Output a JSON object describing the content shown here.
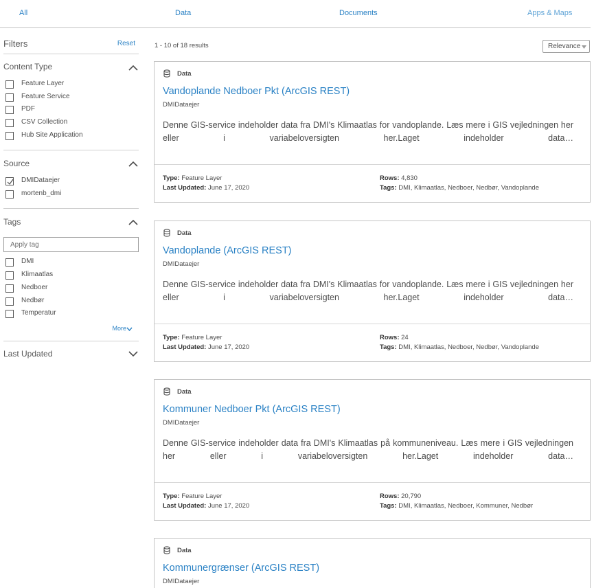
{
  "tabs": [
    {
      "label": "All"
    },
    {
      "label": "Data"
    },
    {
      "label": "Documents"
    },
    {
      "label": "Apps & Maps"
    }
  ],
  "filters": {
    "title": "Filters",
    "reset_label": "Reset",
    "content_type": {
      "title": "Content Type",
      "options": [
        {
          "label": "Feature Layer",
          "checked": false
        },
        {
          "label": "Feature Service",
          "checked": false
        },
        {
          "label": "PDF",
          "checked": false
        },
        {
          "label": "CSV Collection",
          "checked": false
        },
        {
          "label": "Hub Site Application",
          "checked": false
        }
      ]
    },
    "source": {
      "title": "Source",
      "options": [
        {
          "label": "DMIDataejer",
          "checked": true
        },
        {
          "label": "mortenb_dmi",
          "checked": false
        }
      ]
    },
    "tags": {
      "title": "Tags",
      "input_placeholder": "Apply tag",
      "options": [
        {
          "label": "DMI",
          "checked": false
        },
        {
          "label": "Klimaatlas",
          "checked": false
        },
        {
          "label": "Nedboer",
          "checked": false
        },
        {
          "label": "Nedbør",
          "checked": false
        },
        {
          "label": "Temperatur",
          "checked": false
        }
      ],
      "more_label": "More"
    },
    "last_updated": {
      "title": "Last Updated"
    }
  },
  "results": {
    "count_text": "1 - 10 of 18 results",
    "sort_label": "Relevance",
    "type_key": "Type:",
    "updated_key": "Last Updated:",
    "rows_key": "Rows:",
    "tags_key": "Tags:",
    "items": [
      {
        "kind": "Data",
        "title": "Vandoplande Nedboer Pkt (ArcGIS REST)",
        "owner": "DMIDataejer",
        "description": "Denne GIS-service indeholder data fra DMI's Klimaatlas for vandoplande. Læs mere i GIS vejledningen her eller i variabeloversigten her.Laget indeholder data…",
        "type": "Feature Layer",
        "last_updated": "June 17, 2020",
        "rows": "4,830",
        "tags": "DMI, Klimaatlas, Nedboer, Nedbør, Vandoplande"
      },
      {
        "kind": "Data",
        "title": "Vandoplande (ArcGIS REST)",
        "owner": "DMIDataejer",
        "description": "Denne GIS-service indeholder data fra DMI's Klimaatlas for vandoplande. Læs mere i GIS vejledningen her eller i variabeloversigten her.Laget indeholder data…",
        "type": "Feature Layer",
        "last_updated": "June 17, 2020",
        "rows": "24",
        "tags": "DMI, Klimaatlas, Nedboer, Nedbør, Vandoplande"
      },
      {
        "kind": "Data",
        "title": "Kommuner Nedboer Pkt (ArcGIS REST)",
        "owner": "DMIDataejer",
        "description": "Denne GIS-service indeholder data fra DMI's Klimaatlas på kommuneniveau. Læs mere i GIS vejledningen her eller i variabeloversigten her.Laget indeholder data…",
        "type": "Feature Layer",
        "last_updated": "June 17, 2020",
        "rows": "20,790",
        "tags": "DMI, Klimaatlas, Nedboer, Kommuner, Nedbør"
      },
      {
        "kind": "Data",
        "title": "Kommunergrænser (ArcGIS REST)",
        "owner": "DMIDataejer"
      }
    ]
  },
  "colors": {
    "link": "#2b82c5",
    "text": "#4c4c4c",
    "border": "#c4c4c4"
  }
}
